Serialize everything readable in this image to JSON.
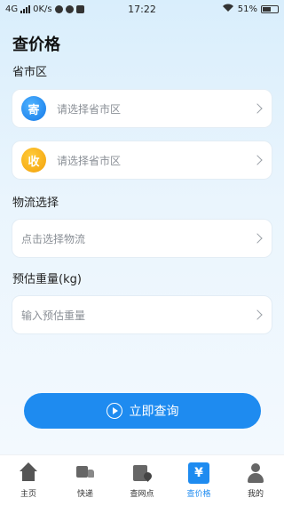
{
  "status_bar": {
    "network": "4G",
    "speed": "0K/s",
    "time": "17:22",
    "battery": "51%"
  },
  "page": {
    "title": "查价格"
  },
  "region": {
    "label": "省市区",
    "sender": {
      "badge": "寄",
      "placeholder": "请选择省市区"
    },
    "receiver": {
      "badge": "收",
      "placeholder": "请选择省市区"
    }
  },
  "logistics": {
    "label": "物流选择",
    "placeholder": "点击选择物流"
  },
  "weight": {
    "label": "预估重量(kg)",
    "placeholder": "输入预估重量"
  },
  "actions": {
    "query_label": "立即查询"
  },
  "tabbar": {
    "items": [
      {
        "label": "主页",
        "icon": "home-icon"
      },
      {
        "label": "快递",
        "icon": "truck-icon"
      },
      {
        "label": "查网点",
        "icon": "box-location-icon"
      },
      {
        "label": "查价格",
        "icon": "yen-icon",
        "badge": "¥"
      },
      {
        "label": "我的",
        "icon": "person-icon"
      }
    ],
    "active": "查价格"
  },
  "colors": {
    "accent": "#1e8bf0",
    "send_badge": "#1478e8",
    "receive_badge": "#f3a10a"
  }
}
